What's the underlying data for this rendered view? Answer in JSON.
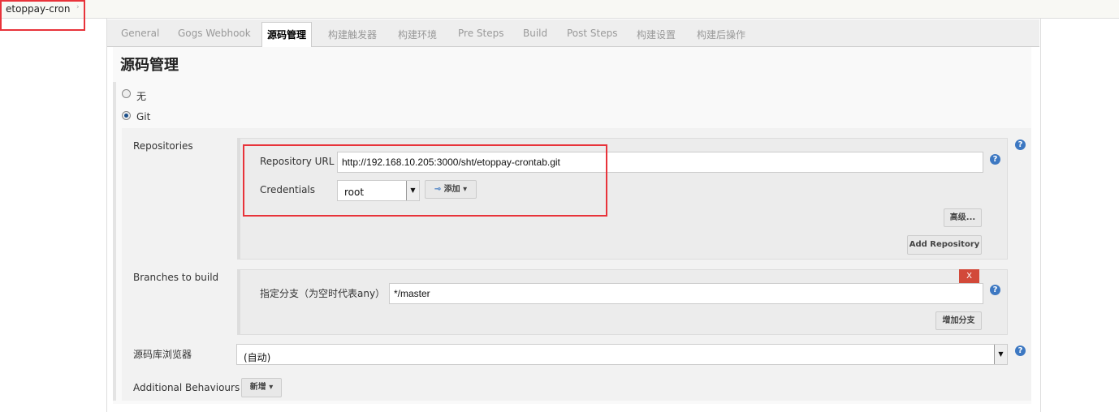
{
  "breadcrumb": {
    "job": "etoppay-cron",
    "arrow": "›"
  },
  "tabs": [
    "General",
    "Gogs Webhook",
    "源码管理",
    "构建触发器",
    "构建环境",
    "Pre Steps",
    "Build",
    "Post Steps",
    "构建设置",
    "构建后操作"
  ],
  "active_tab": "源码管理",
  "section_title": "源码管理",
  "scm": {
    "options": [
      {
        "label": "无",
        "selected": false
      },
      {
        "label": "Git",
        "selected": true
      }
    ]
  },
  "repositories": {
    "label": "Repositories",
    "url_label": "Repository URL",
    "url_value": "http://192.168.10.205:3000/sht/etoppay-crontab.git",
    "credentials_label": "Credentials",
    "credentials_value": "root",
    "add_label": "添加",
    "advanced_label": "高级...",
    "add_repo_label": "Add Repository"
  },
  "branches": {
    "label": "Branches to build",
    "delete_label": "X",
    "branch_label": "指定分支（为空时代表any）",
    "branch_value": "*/master",
    "add_branch_label": "增加分支"
  },
  "browser": {
    "label": "源码库浏览器",
    "value": "(自动)"
  },
  "behaviours": {
    "label": "Additional Behaviours",
    "add_label": "新增"
  },
  "help_glyph": "?",
  "colors": {
    "highlight": "#e8333a",
    "delete": "#d24939",
    "help": "#3d78c2"
  }
}
